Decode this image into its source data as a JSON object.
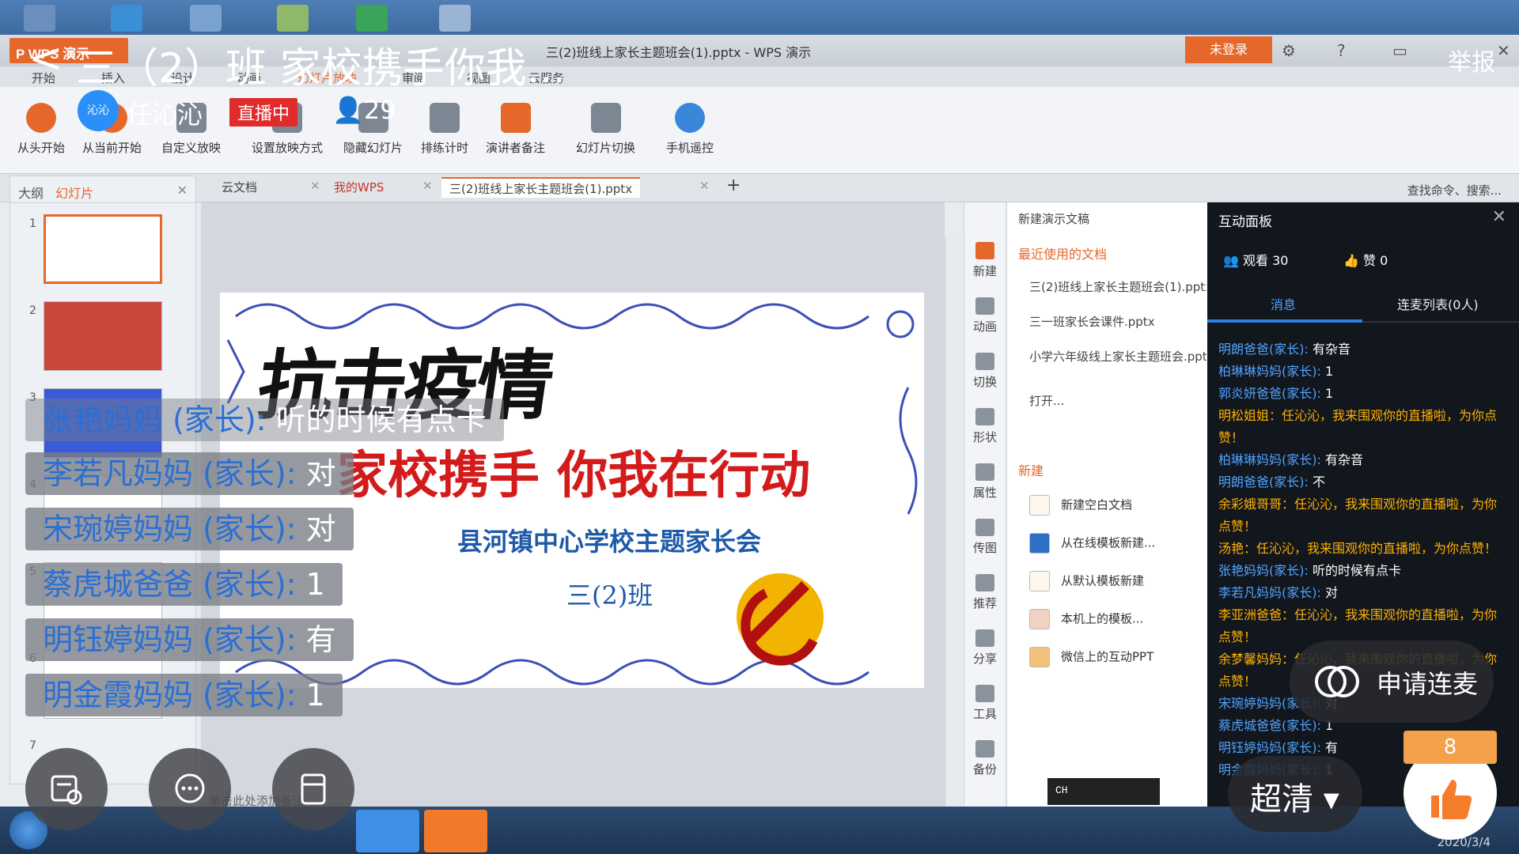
{
  "desktop": {
    "colors": {
      "bar": "#3d6aa0"
    }
  },
  "wps": {
    "logo": "P WPS 演示",
    "doc_title": "三(2)班线上家长主题班会(1).pptx - WPS 演示",
    "login": "未登录",
    "menu": [
      "开始",
      "插入",
      "设计",
      "动画",
      "幻灯片放映",
      "审阅",
      "视图",
      "云服务"
    ],
    "ribbon": [
      "从头开始",
      "从当前开始",
      "自定义放映",
      "设置放映方式",
      "隐藏幻灯片",
      "排练计时",
      "演讲者备注",
      "幻灯片切换",
      "手机遥控"
    ],
    "tabs": [
      "云文档",
      "我的WPS",
      "三(2)班线上家长主题班会(1).pptx"
    ],
    "search": "查找命令、搜索...",
    "left_tabs": {
      "outline": "大纲",
      "slides": "幻灯片"
    },
    "slide_numbers": [
      "1",
      "2",
      "3",
      "4",
      "5",
      "6",
      "7"
    ],
    "notes_placeholder": "单击此处添加备注",
    "slide": {
      "big": "抗击疫情",
      "main": "家校携手  你我在行动",
      "sub": "县河镇中心学校主题家长会",
      "class": "三(2)班"
    },
    "tools": [
      "新建",
      "动画",
      "切换",
      "形状",
      "属性",
      "传图",
      "推荐",
      "分享",
      "工具",
      "备份"
    ],
    "taskpane": {
      "title": "新建演示文稿",
      "recent_label": "最近使用的文档",
      "recent": [
        "三(2)班线上家长主题班会(1).pptx",
        "三一班家长会课件.pptx",
        "小学六年级线上家长主题班会.pptx"
      ],
      "open": "打开...",
      "new_label": "新建",
      "new_items": [
        "新建空白文档",
        "从在线模板新建...",
        "从默认模板新建",
        "本机上的模板...",
        "微信上的互动PPT"
      ]
    },
    "ime": "CH"
  },
  "panel": {
    "title": "互动面板",
    "viewers": "观看 30",
    "likes": "赞 0",
    "tab_msg": "消息",
    "tab_link": "连麦列表(0人)",
    "messages": [
      {
        "u": "明朗爸爸(家长):",
        "t": " 有杂音"
      },
      {
        "u": "柏琳琳妈妈(家长):",
        "t": " 1"
      },
      {
        "u": "郭炎妍爸爸(家长):",
        "t": " 1"
      },
      {
        "sys": "明松姐姐：任沁沁，我来围观你的直播啦，为你点赞！"
      },
      {
        "u": "柏琳琳妈妈(家长):",
        "t": " 有杂音"
      },
      {
        "u": "明朗爸爸(家长):",
        "t": " 不"
      },
      {
        "sys": "余彩娥哥哥：任沁沁，我来围观你的直播啦，为你点赞！"
      },
      {
        "sys": "汤艳：任沁沁，我来围观你的直播啦，为你点赞！"
      },
      {
        "u": "张艳妈妈(家长):",
        "t": " 听的时候有点卡"
      },
      {
        "u": "李若凡妈妈(家长):",
        "t": " 对"
      },
      {
        "sys": "李亚洲爸爸：任沁沁，我来围观你的直播啦，为你点赞！"
      },
      {
        "sys": "余梦馨妈妈：任沁沁，我来围观你的直播啦，为你点赞！"
      },
      {
        "u": "宋琬婷妈妈(家长):",
        "t": " 对"
      },
      {
        "u": "蔡虎城爸爸(家长):",
        "t": " 1"
      },
      {
        "u": "明钰婷妈妈(家长):",
        "t": " 有"
      },
      {
        "u": "明金霞妈妈(家长):",
        "t": " 1"
      }
    ]
  },
  "taskbar": {
    "date": "2020/3/4"
  },
  "overlay": {
    "back": "<",
    "title": "三（2）班 家校携手你我...",
    "report": "举报",
    "avatar_text": "沁沁",
    "host": "任沁沁",
    "live": "直播中",
    "viewers": "29",
    "danmu": [
      {
        "name": "张艳妈妈 (家长):",
        "text": " 听的时候有点卡"
      },
      {
        "name": "李若凡妈妈 (家长):",
        "text": " 对"
      },
      {
        "name": "宋琬婷妈妈 (家长):",
        "text": " 对"
      },
      {
        "name": "蔡虎城爸爸 (家长):",
        "text": " 1"
      },
      {
        "name": "明钰婷妈妈 (家长):",
        "text": " 有"
      },
      {
        "name": "明金霞妈妈 (家长):",
        "text": " 1"
      }
    ],
    "lianmai": "申请连麦",
    "quality": "超清 ▾",
    "like_count": "8",
    "icons": [
      "homework-icon",
      "chat-icon",
      "board-icon"
    ]
  }
}
